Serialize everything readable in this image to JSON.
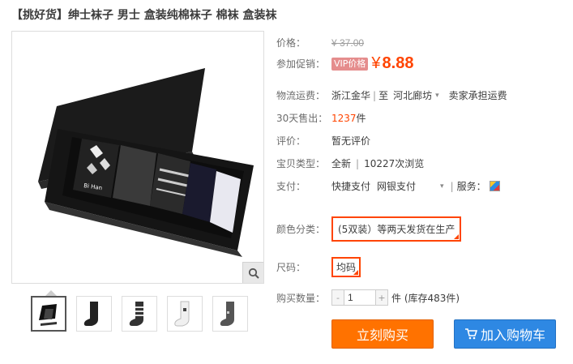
{
  "title": "【挑好货】绅士袜子 男士 盒装纯棉袜子 棉袜 盒装袜",
  "product_image": {
    "box_brand": "Bi Han"
  },
  "thumbnails": [
    "box-socks",
    "black-sock",
    "striped-sock",
    "white-sock",
    "grey-sock"
  ],
  "price": {
    "label": "价格：",
    "old": "¥ 37.00"
  },
  "promo": {
    "label": "参加促销：",
    "tag": "VIP价格",
    "yen": "¥",
    "value": "8.88"
  },
  "shipping": {
    "label": "物流运费：",
    "from": "浙江金华",
    "sep": "至",
    "to": "河北廊坊",
    "note": "卖家承担运费"
  },
  "sold": {
    "label": "30天售出：",
    "count": "1237",
    "unit": "件"
  },
  "review": {
    "label": "评价：",
    "value": "暂无评价"
  },
  "type": {
    "label": "宝贝类型：",
    "condition": "全新",
    "views": "10227次浏览"
  },
  "pay": {
    "label": "支付：",
    "quick": "快捷支付",
    "bank": "网银支付",
    "service_label": "服务："
  },
  "color": {
    "label": "颜色分类：",
    "selected": "(5双装）等两天发货在生产"
  },
  "size": {
    "label": "尺码：",
    "selected": "均码"
  },
  "quantity": {
    "label": "购买数量：",
    "value": "1",
    "minus": "-",
    "plus": "+",
    "stock": "件 (库存483件)"
  },
  "buttons": {
    "buy": "立刻购买",
    "cart": "加入购物车"
  }
}
